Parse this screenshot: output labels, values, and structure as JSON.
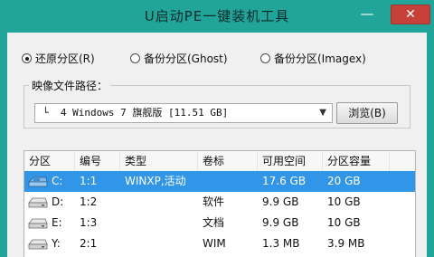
{
  "window": {
    "title": "U启动PE一键装机工具",
    "minimize_glyph": "—",
    "close_glyph": "✕"
  },
  "mode_options": [
    {
      "label": "还原分区(R)",
      "checked": true
    },
    {
      "label": "备份分区(Ghost)",
      "checked": false
    },
    {
      "label": "备份分区(Imagex)",
      "checked": false
    }
  ],
  "image_path": {
    "group_label": "映像文件路径：",
    "selected_value": "└  4 Windows 7 旗舰版 [11.51 GB]",
    "dropdown_icon": "chevron-down-icon",
    "browse_label": "浏览(B)"
  },
  "partition_table": {
    "columns": [
      "分区",
      "编号",
      "类型",
      "卷标",
      "可用空间",
      "分区容量"
    ],
    "rows": [
      {
        "drive": "C:",
        "number": "1:1",
        "type": "WINXP,活动",
        "label": "",
        "free": "17.6 GB",
        "capacity": "20 GB",
        "selected": true,
        "icon": "system-drive-icon"
      },
      {
        "drive": "D:",
        "number": "1:2",
        "type": "",
        "label": "软件",
        "free": "9.9 GB",
        "capacity": "10 GB",
        "selected": false,
        "icon": "hard-drive-icon"
      },
      {
        "drive": "E:",
        "number": "1:3",
        "type": "",
        "label": "文档",
        "free": "9.9 GB",
        "capacity": "10 GB",
        "selected": false,
        "icon": "hard-drive-icon"
      },
      {
        "drive": "Y:",
        "number": "2:1",
        "type": "",
        "label": "WIM",
        "free": "1.3 MB",
        "capacity": "3.9 MB",
        "selected": false,
        "icon": "hard-drive-icon"
      }
    ]
  },
  "colors": {
    "window_frame": "#21a59a",
    "client_background": "#f0f0f0",
    "selection_blue": "#3296e8",
    "close_button": "#c7403a"
  }
}
